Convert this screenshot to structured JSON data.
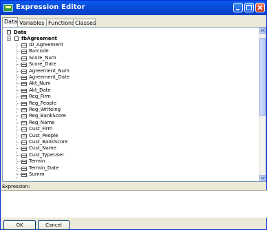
{
  "window": {
    "title": "Expression Editor"
  },
  "tabs": [
    "Data",
    "Variables",
    "Functions",
    "Classes"
  ],
  "tree": {
    "root_label": "Data",
    "dataset_label": "fbAgreement",
    "fields": [
      "ID_Agreement",
      "Barcode",
      "Score_Num",
      "Score_Date",
      "Agreement_Num",
      "Agreement_Date",
      "Akt_Num",
      "Akt_Date",
      "Reg_Firm",
      "Reg_People",
      "Reg_Writeing",
      "Reg_BankScore",
      "Reg_Name",
      "Cust_Firm",
      "Cust_People",
      "Cust_BankScore",
      "Cust_Name",
      "Cust_TypeUser",
      "Termin",
      "Termin_Date",
      "Summ"
    ]
  },
  "expression": {
    "label": "Expression:",
    "value": ""
  },
  "buttons": {
    "ok": "OK",
    "cancel": "Cancel"
  },
  "icons": {
    "app": "expression-editor-icon",
    "field": "field-icon",
    "minimize": "minimize-icon",
    "maximize": "maximize-icon",
    "close": "close-icon"
  },
  "colors": {
    "titlebar": "#0a4bd7",
    "window_bg": "#ece9d8"
  }
}
